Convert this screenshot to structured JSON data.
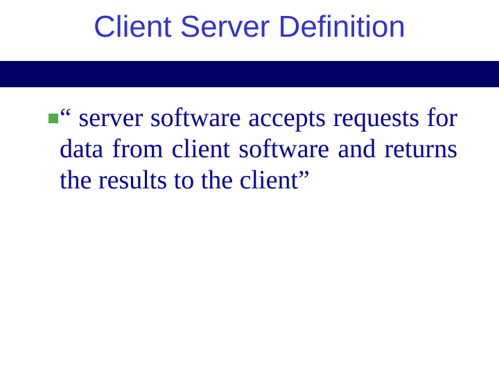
{
  "slide": {
    "title": "Client Server Definition",
    "bullets": [
      {
        "text": "“  server  software  accepts requests for data from client software and returns the results to the client”"
      }
    ]
  },
  "colors": {
    "title": "#3333cc",
    "body": "#000099",
    "bullet": "#4eae49",
    "band": "#000066"
  }
}
